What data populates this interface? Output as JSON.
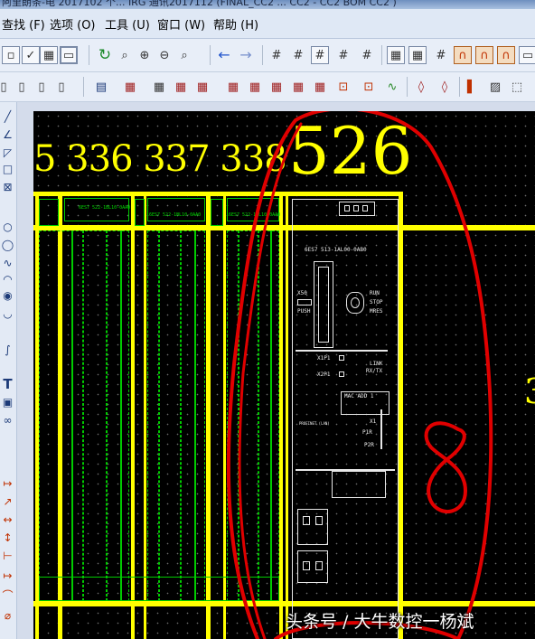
{
  "titlebar": {
    "text": "阿里朗条-电 2017102 个...  IRG 通讯2017112 (FINAL_CC2 ... CC2 - CC2 BOM CC2 )"
  },
  "menu": {
    "items": [
      "查找 (F)",
      "选项 (O)",
      "工具 (U)",
      "窗口 (W)",
      "帮助 (H)"
    ]
  },
  "drawing": {
    "column_numbers": "5 336 337 338",
    "big_number": "526",
    "right_partial": "3",
    "module_labels": {
      "module_a": "6ES7 522-1BL10-0AA0",
      "module_b": "6ES7 522-1BL10-0AA0",
      "module_c": "6ES7 522-1BL10-0AA0",
      "cpu_part": "6ES7 513-1AL00-0AB0",
      "x50": "X50",
      "push": "PUSH",
      "run": "RUN",
      "stop": "STOP",
      "mres": "MRES",
      "x1p1": "X1P1",
      "x2p1": "X2P1",
      "link": "LINK",
      "rxtx": "RX/TX",
      "mac": "MAC ADD 1",
      "profinet": "PROFINET (LAN)",
      "x1": "X1",
      "p1r": "P1R",
      "p2r": "P2R"
    },
    "annotation_number": "8"
  },
  "watermark": "头条号 / 大牛数控一杨斌",
  "colors": {
    "accent_yellow": "#ffff00",
    "circuit_green": "#00cc00",
    "annotation_red": "#e00000",
    "canvas_bg": "#000000"
  }
}
